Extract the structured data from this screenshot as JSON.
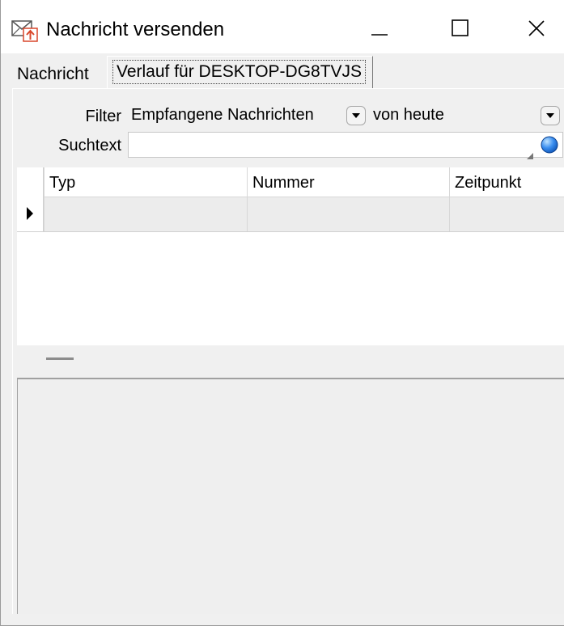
{
  "window": {
    "title": "Nachricht versenden",
    "app_icon": "mail-send-icon",
    "controls": {
      "minimize_icon": "minimize-icon",
      "maximize_icon": "maximize-icon",
      "close_icon": "close-icon"
    }
  },
  "tabs": [
    {
      "label": "Nachricht",
      "active": false
    },
    {
      "label": "Verlauf für DESKTOP-DG8TVJS",
      "active": true
    }
  ],
  "filter": {
    "label": "Filter",
    "type_value": "Empfangene Nachrichten",
    "period_value": "von heute",
    "dropdown_icon": "chevron-down-icon"
  },
  "search": {
    "label": "Suchtext",
    "value": "",
    "go_icon": "globe-search-icon"
  },
  "grid": {
    "columns": [
      "Typ",
      "Nummer",
      "Zeitpunkt"
    ],
    "rows": [
      {
        "typ": "",
        "nummer": "",
        "zeitpunkt": "",
        "current": true
      }
    ],
    "row_indicator_icon": "row-pointer-icon"
  },
  "colors": {
    "window_bg": "#f0f0f0",
    "accent_red": "#d9472b",
    "globe_blue": "#1f6fd6"
  }
}
